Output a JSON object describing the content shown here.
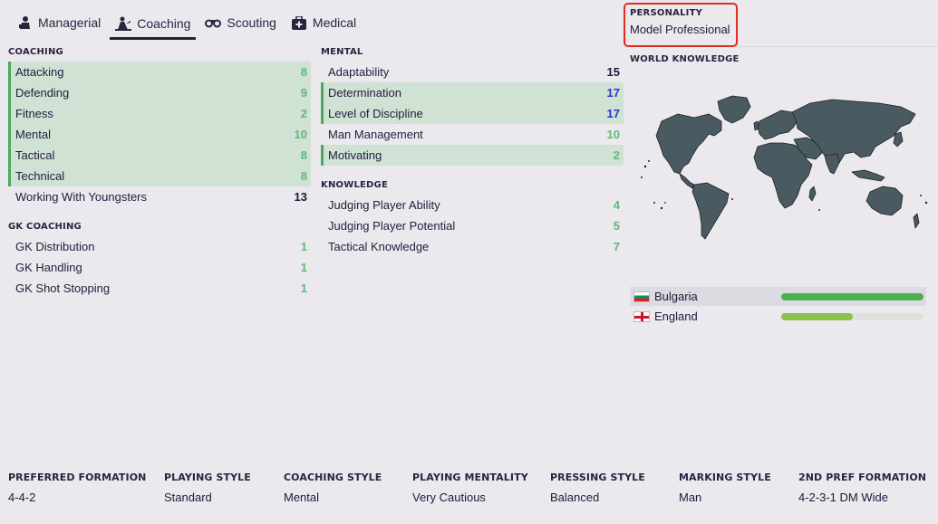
{
  "tabs": [
    {
      "label": "Managerial",
      "icon": "manager-icon"
    },
    {
      "label": "Coaching",
      "icon": "coach-icon",
      "active": true
    },
    {
      "label": "Scouting",
      "icon": "binoculars-icon"
    },
    {
      "label": "Medical",
      "icon": "medical-kit-icon"
    }
  ],
  "coaching": {
    "title": "COACHING",
    "rows": [
      {
        "label": "Attacking",
        "value": "8"
      },
      {
        "label": "Defending",
        "value": "9"
      },
      {
        "label": "Fitness",
        "value": "2"
      },
      {
        "label": "Mental",
        "value": "10"
      },
      {
        "label": "Tactical",
        "value": "8"
      },
      {
        "label": "Technical",
        "value": "8"
      },
      {
        "label": "Working With Youngsters",
        "value": "13"
      }
    ]
  },
  "gk_coaching": {
    "title": "GK COACHING",
    "rows": [
      {
        "label": "GK Distribution",
        "value": "1"
      },
      {
        "label": "GK Handling",
        "value": "1"
      },
      {
        "label": "GK Shot Stopping",
        "value": "1"
      }
    ]
  },
  "mental": {
    "title": "MENTAL",
    "rows": [
      {
        "label": "Adaptability",
        "value": "15"
      },
      {
        "label": "Determination",
        "value": "17"
      },
      {
        "label": "Level of Discipline",
        "value": "17"
      },
      {
        "label": "Man Management",
        "value": "10"
      },
      {
        "label": "Motivating",
        "value": "2"
      }
    ]
  },
  "knowledge": {
    "title": "KNOWLEDGE",
    "rows": [
      {
        "label": "Judging Player Ability",
        "value": "4"
      },
      {
        "label": "Judging Player Potential",
        "value": "5"
      },
      {
        "label": "Tactical Knowledge",
        "value": "7"
      }
    ]
  },
  "personality": {
    "title": "PERSONALITY",
    "value": "Model Professional"
  },
  "world_knowledge": {
    "title": "WORLD KNOWLEDGE",
    "countries": [
      {
        "name": "Bulgaria",
        "level": 1.0,
        "color": "#4caf50"
      },
      {
        "name": "England",
        "level": 0.5,
        "color": "#8bc34a"
      }
    ]
  },
  "bottom": [
    {
      "title": "PREFERRED FORMATION",
      "value": "4-4-2"
    },
    {
      "title": "PLAYING STYLE",
      "value": "Standard"
    },
    {
      "title": "COACHING STYLE",
      "value": "Mental"
    },
    {
      "title": "PLAYING MENTALITY",
      "value": "Very Cautious"
    },
    {
      "title": "PRESSING STYLE",
      "value": "Balanced"
    },
    {
      "title": "MARKING STYLE",
      "value": "Man"
    },
    {
      "title": "2ND PREF FORMATION",
      "value": "4-2-3-1 DM Wide"
    }
  ],
  "colors": {
    "highlight_bg": "#cfe2d4",
    "highlight_edge": "#4ba95a",
    "value_green": "#5fb878",
    "value_blue": "#2a35c9",
    "personality_border": "#e22a1e",
    "map_land": "#4a5a61"
  }
}
